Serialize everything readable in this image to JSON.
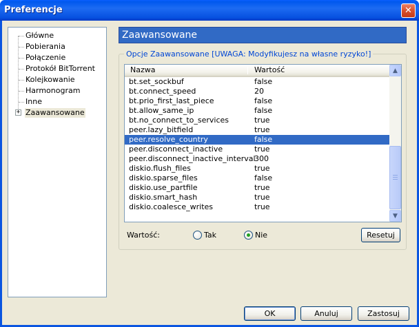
{
  "window": {
    "title": "Preferencje"
  },
  "tree": {
    "items": [
      {
        "label": "Główne"
      },
      {
        "label": "Pobierania"
      },
      {
        "label": "Połączenie"
      },
      {
        "label": "Protokół BitTorrent"
      },
      {
        "label": "Kolejkowanie"
      },
      {
        "label": "Harmonogram"
      },
      {
        "label": "Inne"
      },
      {
        "label": "Zaawansowane"
      }
    ],
    "selected": "Zaawansowane"
  },
  "section": {
    "title": "Zaawansowane"
  },
  "group": {
    "title": "Opcje Zaawansowane [UWAGA: Modyfikujesz na własne ryzyko!]"
  },
  "table": {
    "columns": [
      "Nazwa",
      "Wartość"
    ],
    "rows": [
      {
        "name": "bt.set_sockbuf",
        "value": "false"
      },
      {
        "name": "bt.connect_speed",
        "value": "20"
      },
      {
        "name": "bt.prio_first_last_piece",
        "value": "false"
      },
      {
        "name": "bt.allow_same_ip",
        "value": "false"
      },
      {
        "name": "bt.no_connect_to_services",
        "value": "true"
      },
      {
        "name": "peer.lazy_bitfield",
        "value": "true"
      },
      {
        "name": "peer.resolve_country",
        "value": "false"
      },
      {
        "name": "peer.disconnect_inactive",
        "value": "true"
      },
      {
        "name": "peer.disconnect_inactive_interval",
        "value": "300"
      },
      {
        "name": "diskio.flush_files",
        "value": "true"
      },
      {
        "name": "diskio.sparse_files",
        "value": "false"
      },
      {
        "name": "diskio.use_partfile",
        "value": "true"
      },
      {
        "name": "diskio.smart_hash",
        "value": "true"
      },
      {
        "name": "diskio.coalesce_writes",
        "value": "true"
      }
    ],
    "selected_row": "peer.resolve_country"
  },
  "value_editor": {
    "label": "Wartość:",
    "option_yes": "Tak",
    "option_no": "Nie",
    "selected": "Nie",
    "reset_label": "Resetuj"
  },
  "buttons": {
    "ok": "OK",
    "cancel": "Anuluj",
    "apply": "Zastosuj"
  },
  "colors": {
    "selection": "#316ac5",
    "titlebar": "#0a55e0",
    "group_title": "#0046d5"
  }
}
